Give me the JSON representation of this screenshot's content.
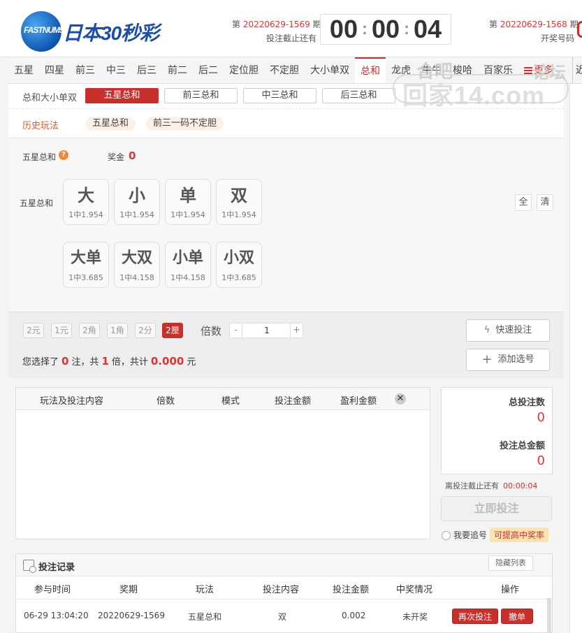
{
  "header": {
    "logo_brand": "FASTNUM5",
    "logo_title": "日本30秒彩",
    "current_issue_prefix": "第",
    "current_issue": "20220629-1569",
    "current_issue_suffix": "期",
    "deadline_label": "投注截止还有",
    "timer": {
      "h": "00",
      "m": "00",
      "s": "04"
    },
    "prev_issue_prefix": "第",
    "prev_issue": "20220629-1568",
    "prev_issue_suffix": "期",
    "prev_label": "开奖号码"
  },
  "nav": {
    "tabs": [
      "五星",
      "四星",
      "前三",
      "中三",
      "后三",
      "前二",
      "后二",
      "定位胆",
      "不定胆",
      "大小单双",
      "总和",
      "龙虎",
      "牛牛",
      "梭哈",
      "百家乐"
    ],
    "active": "总和",
    "more_label": "更多",
    "edge_label": "近"
  },
  "subnav": {
    "label": "总和大小单双",
    "items": [
      "五星总和",
      "前三总和",
      "中三总和",
      "后三总和"
    ],
    "active": "五星总和"
  },
  "history": {
    "label": "历史玩法",
    "items": [
      "五星总和",
      "前三一码不定胆"
    ]
  },
  "watermark": {
    "t1": "合吧",
    "t2": "论坛",
    "t3": "回家14.com"
  },
  "bet": {
    "title": "五星总和",
    "help_icon": "question-icon",
    "prize_label": "奖金",
    "prize_value": "0",
    "row_label": "五星总和",
    "balls": [
      {
        "label": "大",
        "odds": "1中1.954"
      },
      {
        "label": "小",
        "odds": "1中1.954"
      },
      {
        "label": "单",
        "odds": "1中1.954"
      },
      {
        "label": "双",
        "odds": "1中1.954"
      },
      {
        "label": "大单",
        "odds": "1中3.685"
      },
      {
        "label": "大双",
        "odds": "1中4.158"
      },
      {
        "label": "小单",
        "odds": "1中4.158"
      },
      {
        "label": "小双",
        "odds": "1中3.685"
      }
    ],
    "select_all": "全",
    "clear": "清"
  },
  "mode": {
    "options": [
      "2元",
      "1元",
      "2角",
      "1角",
      "2分",
      "2厘"
    ],
    "active": "2厘",
    "multiplier_label": "倍数",
    "minus": "-",
    "multiplier": "1",
    "plus": "+",
    "summary": {
      "t1": "您选择了",
      "bets": "0",
      "t2": "注，共",
      "mult": "1",
      "t3": "倍，共计",
      "amount": "0.000",
      "t4": "元"
    },
    "quick_bet": "快速投注",
    "add_selection": "添加选号"
  },
  "orders": {
    "columns": [
      "玩法及投注内容",
      "倍数",
      "模式",
      "投注金额",
      "盈利金额"
    ],
    "clear_icon": "close-icon"
  },
  "summary_box": {
    "total_bets_label": "总投注数",
    "total_bets": "0",
    "total_amount_label": "投注总金额",
    "total_amount": "0",
    "deadline_label": "离投注截止还有",
    "deadline": "00:00:04",
    "submit": "立即投注",
    "chase_label": "我要追号",
    "chase_badge": "可提高中奖率"
  },
  "records": {
    "title": "投注记录",
    "hide": "隐藏列表",
    "columns": [
      "参与时间",
      "奖期",
      "玩法",
      "投注内容",
      "投注金额",
      "中奖情况",
      "操作"
    ],
    "rows": [
      {
        "time": "06-29 13:04:20",
        "issue": "20220629-1569",
        "play": "五星总和",
        "content": "双",
        "amount": "0.002",
        "status": "未开奖",
        "rebet": "再次投注",
        "cancel": "撤单"
      }
    ]
  },
  "colors": {
    "accent": "#c9302c",
    "brand_blue": "#1a4ea8",
    "badge_bg": "#fbe3b0"
  }
}
